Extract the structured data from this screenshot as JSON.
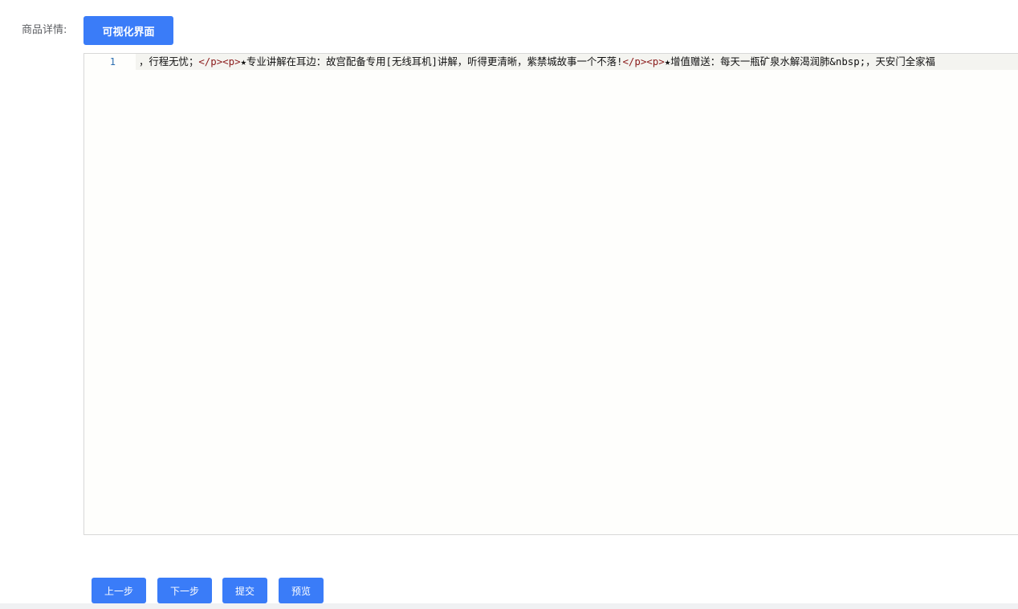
{
  "form": {
    "label": "商品详情:",
    "toggle_button_label": "可视化界面"
  },
  "editor": {
    "line_number": "1",
    "segments": [
      {
        "type": "text",
        "text": "，行程无忧；"
      },
      {
        "type": "tag",
        "text": "</p><p>"
      },
      {
        "type": "text",
        "text": "★专业讲解在耳边：故宫配备专用[无线耳机]讲解，听得更清晰，紫禁城故事一个不落!"
      },
      {
        "type": "tag",
        "text": "</p><p>"
      },
      {
        "type": "text",
        "text": "★增值赠送：每天一瓶矿泉水解渴润肺&nbsp;，天安门全家福"
      }
    ]
  },
  "actions": {
    "prev_label": "上一步",
    "next_label": "下一步",
    "submit_label": "提交",
    "preview_label": "预览"
  },
  "colors": {
    "primary": "#3a7cf8",
    "tag": "#8b1c1c",
    "line_number": "#2b6eb0",
    "editor_bg": "#fefefc",
    "editor_border": "#d8d8d8"
  }
}
